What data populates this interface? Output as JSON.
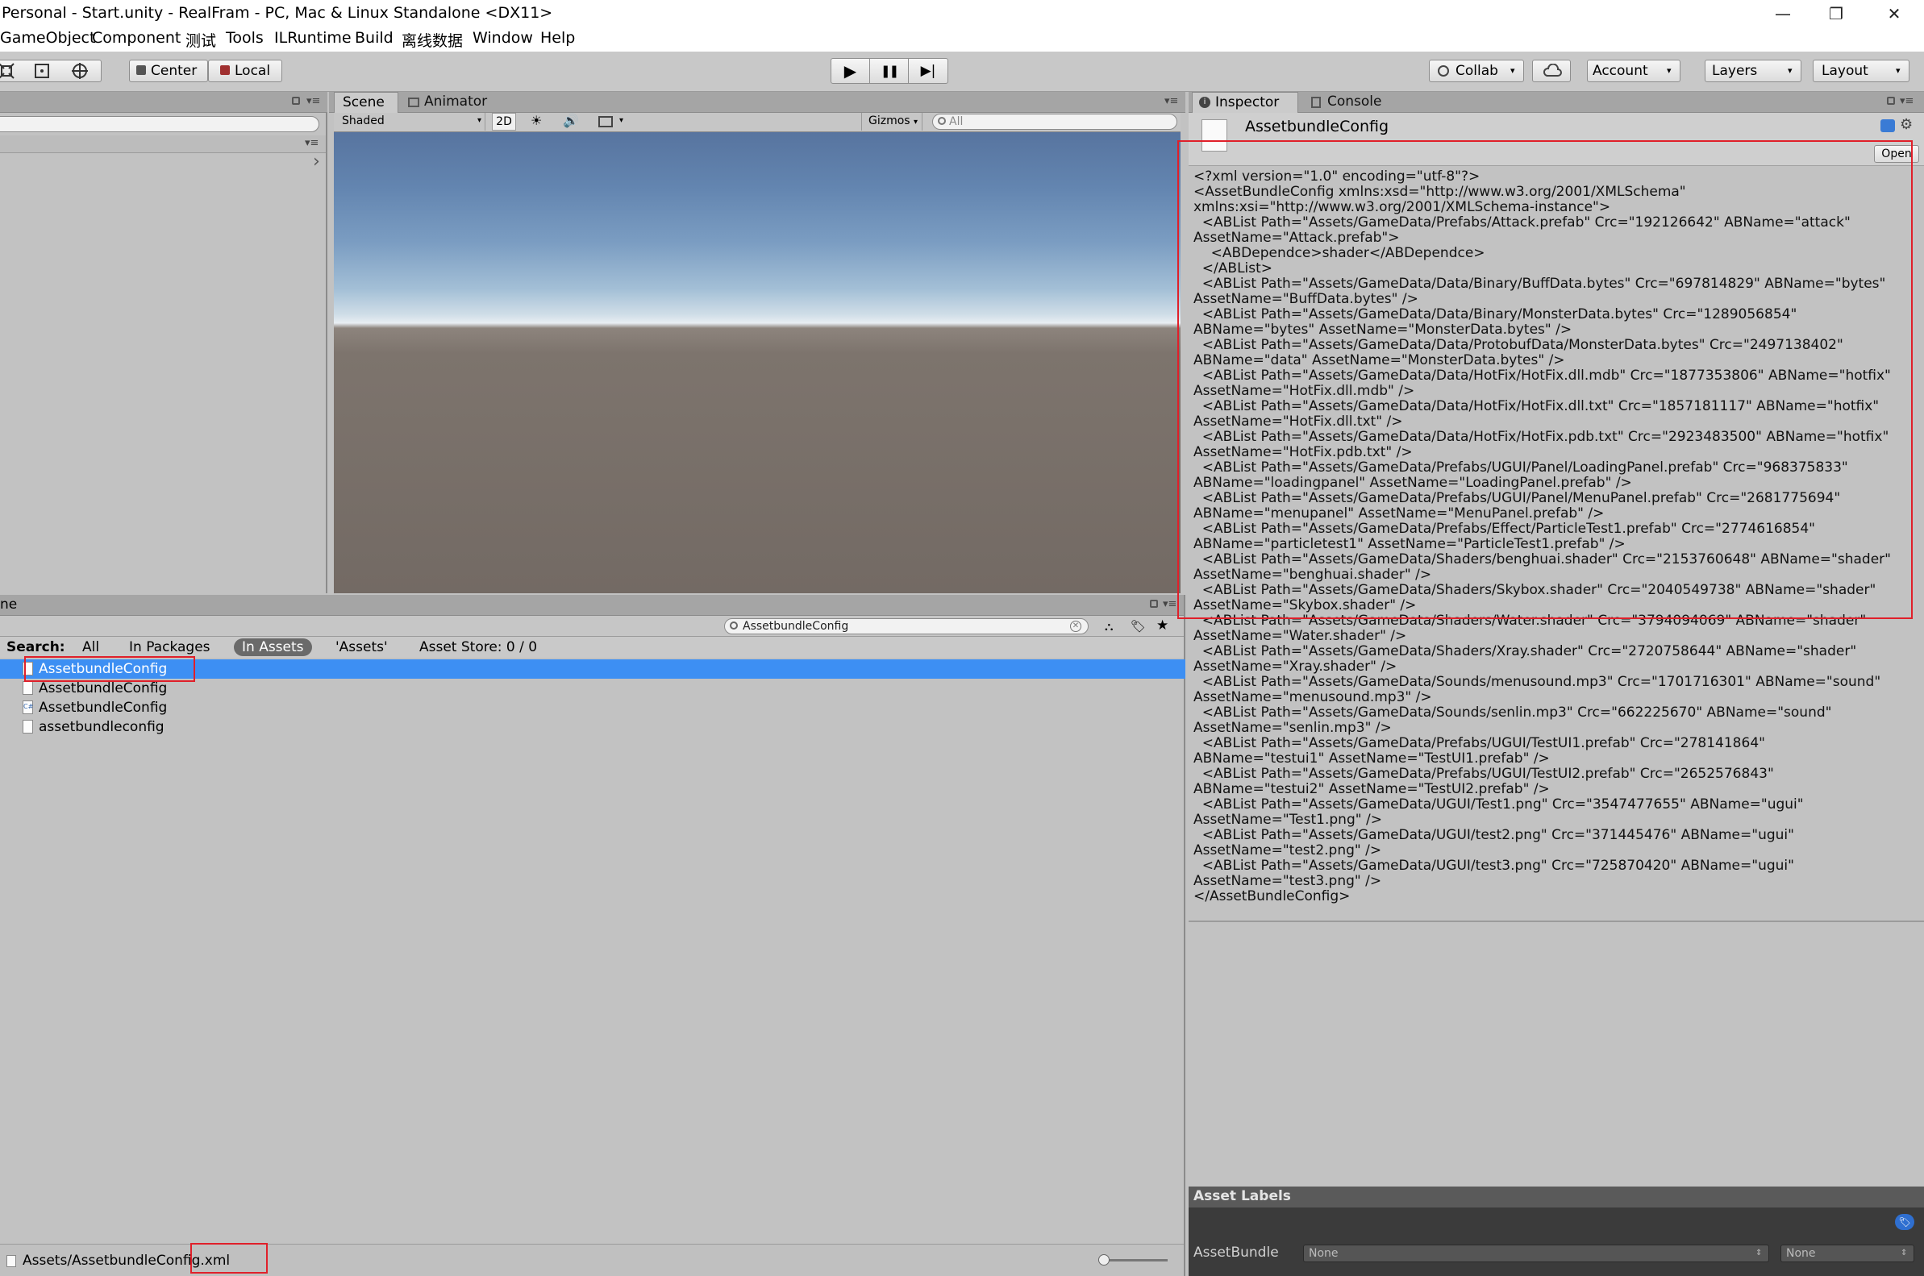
{
  "window": {
    "title": "Personal - Start.unity - RealFram - PC, Mac & Linux Standalone <DX11>",
    "minimize": "—",
    "maximize": "❐",
    "close": "✕"
  },
  "menu": [
    "GameObject",
    "Component",
    "测试",
    "Tools",
    "ILRuntime",
    "Build",
    "离线数据",
    "Window",
    "Help"
  ],
  "toolbar": {
    "pivot_center": "Center",
    "pivot_local": "Local",
    "play_icon": "▶",
    "pause_icon": "❚❚",
    "step_icon": "▶|",
    "collab": "Collab",
    "account": "Account",
    "layers": "Layers",
    "layout": "Layout",
    "dropdown_arrow": "▾"
  },
  "scene": {
    "tabs": [
      "Scene",
      "Animator"
    ],
    "shading": "Shaded",
    "mode_2d": "2D",
    "gizmos": "Gizmos",
    "search_placeholder": "All"
  },
  "hierarchy": {
    "collapse_arrow": "›"
  },
  "project": {
    "header_fragment": "ne",
    "search_value": "AssetbundleConfig",
    "filter_label": "Search:",
    "filters": [
      "All",
      "In Packages",
      "In Assets",
      "'Assets'",
      "Asset Store: 0 / 0"
    ],
    "assets": [
      "AssetbundleConfig",
      "AssetbundleConfig",
      "AssetbundleConfig",
      "assetbundleconfig"
    ],
    "footer_path": "Assets/AssetbundleConfig.xml"
  },
  "inspector": {
    "tabs": [
      "Inspector",
      "Console"
    ],
    "asset_title": "AssetbundleConfig",
    "open_button": "Open",
    "xml_content": "<?xml version=\"1.0\" encoding=\"utf-8\"?>\n<AssetBundleConfig xmlns:xsd=\"http://www.w3.org/2001/XMLSchema\"\nxmlns:xsi=\"http://www.w3.org/2001/XMLSchema-instance\">\n  <ABList Path=\"Assets/GameData/Prefabs/Attack.prefab\" Crc=\"192126642\" ABName=\"attack\"\nAssetName=\"Attack.prefab\">\n    <ABDependce>shader</ABDependce>\n  </ABList>\n  <ABList Path=\"Assets/GameData/Data/Binary/BuffData.bytes\" Crc=\"697814829\" ABName=\"bytes\"\nAssetName=\"BuffData.bytes\" />\n  <ABList Path=\"Assets/GameData/Data/Binary/MonsterData.bytes\" Crc=\"1289056854\"\nABName=\"bytes\" AssetName=\"MonsterData.bytes\" />\n  <ABList Path=\"Assets/GameData/Data/ProtobufData/MonsterData.bytes\" Crc=\"2497138402\"\nABName=\"data\" AssetName=\"MonsterData.bytes\" />\n  <ABList Path=\"Assets/GameData/Data/HotFix/HotFix.dll.mdb\" Crc=\"1877353806\" ABName=\"hotfix\"\nAssetName=\"HotFix.dll.mdb\" />\n  <ABList Path=\"Assets/GameData/Data/HotFix/HotFix.dll.txt\" Crc=\"1857181117\" ABName=\"hotfix\"\nAssetName=\"HotFix.dll.txt\" />\n  <ABList Path=\"Assets/GameData/Data/HotFix/HotFix.pdb.txt\" Crc=\"2923483500\" ABName=\"hotfix\"\nAssetName=\"HotFix.pdb.txt\" />\n  <ABList Path=\"Assets/GameData/Prefabs/UGUI/Panel/LoadingPanel.prefab\" Crc=\"968375833\"\nABName=\"loadingpanel\" AssetName=\"LoadingPanel.prefab\" />\n  <ABList Path=\"Assets/GameData/Prefabs/UGUI/Panel/MenuPanel.prefab\" Crc=\"2681775694\"\nABName=\"menupanel\" AssetName=\"MenuPanel.prefab\" />\n  <ABList Path=\"Assets/GameData/Prefabs/Effect/ParticleTest1.prefab\" Crc=\"2774616854\"\nABName=\"particletest1\" AssetName=\"ParticleTest1.prefab\" />\n  <ABList Path=\"Assets/GameData/Shaders/benghuai.shader\" Crc=\"2153760648\" ABName=\"shader\"\nAssetName=\"benghuai.shader\" />\n  <ABList Path=\"Assets/GameData/Shaders/Skybox.shader\" Crc=\"2040549738\" ABName=\"shader\"\nAssetName=\"Skybox.shader\" />\n  <ABList Path=\"Assets/GameData/Shaders/Water.shader\" Crc=\"3794094069\" ABName=\"shader\"\nAssetName=\"Water.shader\" />\n  <ABList Path=\"Assets/GameData/Shaders/Xray.shader\" Crc=\"2720758644\" ABName=\"shader\"\nAssetName=\"Xray.shader\" />\n  <ABList Path=\"Assets/GameData/Sounds/menusound.mp3\" Crc=\"1701716301\" ABName=\"sound\"\nAssetName=\"menusound.mp3\" />\n  <ABList Path=\"Assets/GameData/Sounds/senlin.mp3\" Crc=\"662225670\" ABName=\"sound\"\nAssetName=\"senlin.mp3\" />\n  <ABList Path=\"Assets/GameData/Prefabs/UGUI/TestUI1.prefab\" Crc=\"278141864\"\nABName=\"testui1\" AssetName=\"TestUI1.prefab\" />\n  <ABList Path=\"Assets/GameData/Prefabs/UGUI/TestUI2.prefab\" Crc=\"2652576843\"\nABName=\"testui2\" AssetName=\"TestUI2.prefab\" />\n  <ABList Path=\"Assets/GameData/UGUI/Test1.png\" Crc=\"3547477655\" ABName=\"ugui\"\nAssetName=\"Test1.png\" />\n  <ABList Path=\"Assets/GameData/UGUI/test2.png\" Crc=\"371445476\" ABName=\"ugui\"\nAssetName=\"test2.png\" />\n  <ABList Path=\"Assets/GameData/UGUI/test3.png\" Crc=\"725870420\" ABName=\"ugui\"\nAssetName=\"test3.png\" />\n</AssetBundleConfig>",
    "asset_labels_title": "Asset Labels",
    "assetbundle_label": "AssetBundle",
    "assetbundle_name": "None",
    "assetbundle_variant": "None"
  },
  "colors": {
    "selection": "#3d8ff3",
    "annotation_red": "#e0202a",
    "panel_bg": "#c2c2c2"
  }
}
